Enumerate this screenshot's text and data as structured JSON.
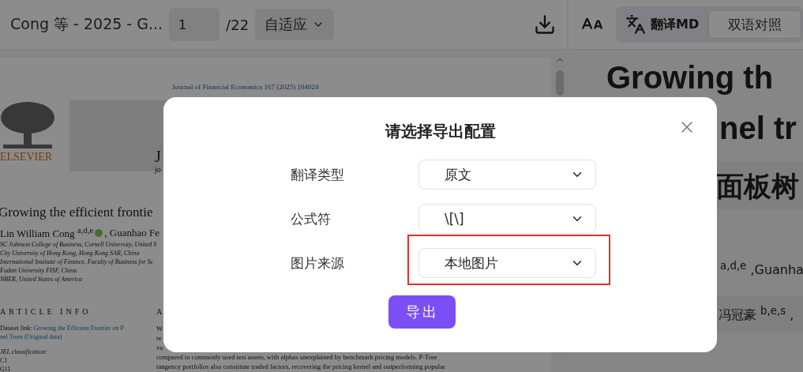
{
  "toolbar": {
    "doc_title": "Cong 等 - 2025 - G...",
    "page_input": "1",
    "page_total": "/22",
    "zoom": "自适应",
    "translate_label": "翻译MD",
    "bilingual_label": "双语对照"
  },
  "pdf": {
    "journal_line": "Journal of Financial Economics 167 (2025) 104024",
    "publisher": "ELSEVIER",
    "header_fragments": [
      "J",
      "jo"
    ],
    "title": "Growing the efficient frontie",
    "authors_first": "Lin William Cong $^{a,d,e}$",
    "authors_rest": ", Guanhao Fe",
    "affiliations": [
      "SC Johnson College of Business, Cornell University, United S",
      "City University of Hong Kong, Hong Kong SAR, China",
      "International Institute of Finance, Faculty of Business for Sc",
      "Fudan University FISF, China",
      "NBER, United States of America"
    ],
    "article_info": "ARTICLE INFO",
    "dataset_label": "Dataset link:",
    "dataset_link": "Growing the Efficient Frontier on P",
    "dataset_link_2": "nel Trees (Original data)",
    "jel_label": "JEL classification:",
    "jel_codes": [
      "C1",
      "G11"
    ],
    "abstract_heading": "A",
    "abstract_lines": [
      "W",
      "re",
      "va",
      "compared to commonly used test assets, with alphas unexplained by benchmark pricing models. P-Tree",
      "tangency portfolios also constitute traded factors, recovering the pricing kernel and outperforming popular"
    ]
  },
  "translation": {
    "title_lines": [
      "Growing th",
      "nel tr"
    ],
    "title_zh": "面板树",
    "authors_line": "$^{a,d,e}$ ,Guanha",
    "authors_zh": "冯冠豪 $^{b,e,s}$ ,"
  },
  "dialog": {
    "title": "请选择导出配置",
    "fields": [
      {
        "label": "翻译类型",
        "value": "原文",
        "highlighted": false
      },
      {
        "label": "公式符",
        "value": "\\[\\]",
        "highlighted": false
      },
      {
        "label": "图片来源",
        "value": "本地图片",
        "highlighted": true
      }
    ],
    "export_button": "导出"
  }
}
